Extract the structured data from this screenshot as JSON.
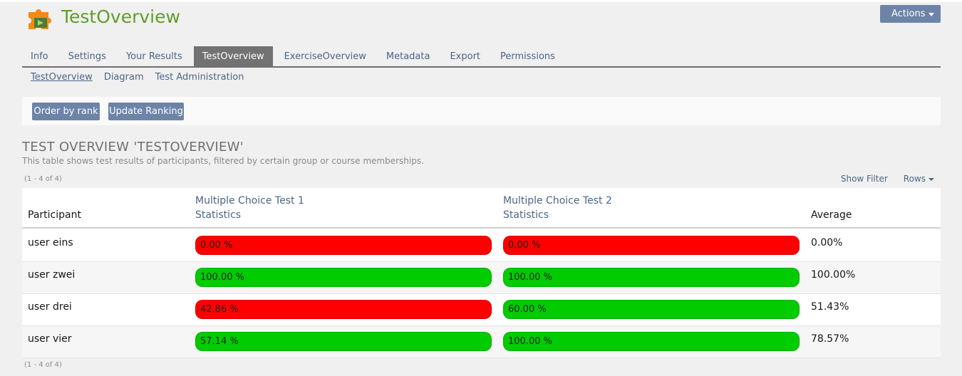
{
  "header": {
    "title": "TestOverview",
    "actions_label": "Actions"
  },
  "tabs": [
    {
      "label": "Info",
      "active": false
    },
    {
      "label": "Settings",
      "active": false
    },
    {
      "label": "Your Results",
      "active": false
    },
    {
      "label": "TestOverview",
      "active": true
    },
    {
      "label": "ExerciseOverview",
      "active": false
    },
    {
      "label": "Metadata",
      "active": false
    },
    {
      "label": "Export",
      "active": false
    },
    {
      "label": "Permissions",
      "active": false
    }
  ],
  "subtabs": [
    {
      "label": "TestOverview",
      "active": true
    },
    {
      "label": "Diagram",
      "active": false
    },
    {
      "label": "Test Administration",
      "active": false
    }
  ],
  "toolbar": {
    "order_label": "Order by rank",
    "update_label": "Update Ranking"
  },
  "section": {
    "title": "TEST OVERVIEW 'TESTOVERVIEW'",
    "description": "This table shows test results of participants, filtered by certain group or course memberships."
  },
  "table": {
    "range_top": "(1 - 4 of 4)",
    "range_bottom": "(1 - 4 of 4)",
    "show_filter": "Show Filter",
    "rows_label": "Rows",
    "columns": {
      "participant": "Participant",
      "test1_name": "Multiple Choice Test 1",
      "test1_stats": "Statistics",
      "test2_name": "Multiple Choice Test 2",
      "test2_stats": "Statistics",
      "average": "Average"
    },
    "rows": [
      {
        "participant": "user eins",
        "test1": "0.00 %",
        "test1_status": "fail",
        "test2": "0.00 %",
        "test2_status": "fail",
        "average": "0.00%"
      },
      {
        "participant": "user zwei",
        "test1": "100.00 %",
        "test1_status": "pass",
        "test2": "100.00 %",
        "test2_status": "pass",
        "average": "100.00%"
      },
      {
        "participant": "user drei",
        "test1": "42.86 %",
        "test1_status": "fail",
        "test2": "60.00 %",
        "test2_status": "pass",
        "average": "51.43%"
      },
      {
        "participant": "user vier",
        "test1": "57.14 %",
        "test1_status": "pass",
        "test2": "100.00 %",
        "test2_status": "pass",
        "average": "78.57%"
      }
    ]
  },
  "colors": {
    "title_green": "#5f9e29",
    "link_blue": "#4c6586",
    "button_blue": "#6d84a8",
    "pass_green": "#00cc00",
    "fail_red": "#ff0000"
  }
}
